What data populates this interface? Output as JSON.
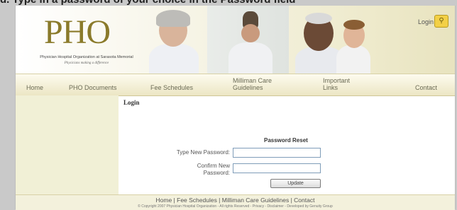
{
  "caption": "d. Type in a password of your choice in the Password field",
  "header": {
    "logo": "PHO",
    "org_name": "Physician Hospital Organization at Sarasota Memorial",
    "tagline": "Physicians making a difference",
    "login_label": "Login"
  },
  "nav": {
    "items": [
      {
        "label": "Home"
      },
      {
        "label": "PHO Documents"
      },
      {
        "label": "Fee Schedules"
      },
      {
        "label": "Milliman Care Guidelines"
      },
      {
        "label": "Important Links"
      },
      {
        "label": "Contact"
      }
    ]
  },
  "content": {
    "title": "Login",
    "form_title": "Password Reset",
    "new_password_label": "Type New Password:",
    "confirm_password_label": "Confirm New Password:",
    "new_password_value": "",
    "confirm_password_value": "",
    "update_label": "Update"
  },
  "footer": {
    "links": "Home | Fee Schedules | Milliman Care Guidelines | Contact",
    "copyright": "© Copyright 2007 Physician Hospital Organization - All rights Reserved - Privacy - Disclaimer - Developed by Genuity Group"
  },
  "colors": {
    "header_gold": "#e8e3bf",
    "logo": "#8a7a2a",
    "sidebar": "#f1f0d6",
    "login_icon": "#f3d046"
  }
}
